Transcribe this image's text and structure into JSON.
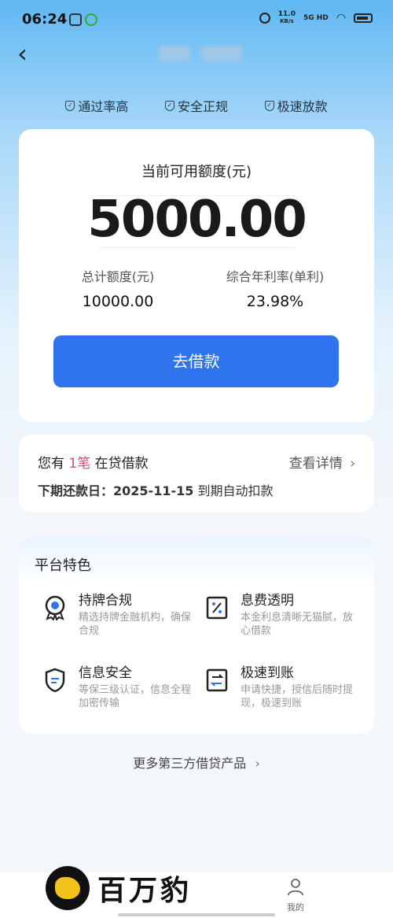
{
  "status_bar": {
    "time": "06:24",
    "net_speed_value": "11.0",
    "net_speed_unit": "KB/s",
    "network": "5G HD"
  },
  "badges": [
    "通过率高",
    "安全正规",
    "极速放款"
  ],
  "quota": {
    "label": "当前可用额度(元)",
    "amount": "5000.00",
    "total_label": "总计额度(元)",
    "total_value": "10000.00",
    "rate_label": "综合年利率(单利)",
    "rate_value": "23.98%",
    "button": "去借款"
  },
  "loan": {
    "prefix": "您有 ",
    "count": "1笔",
    "suffix": " 在贷借款",
    "more": "查看详情",
    "next_label": "下期还款日：",
    "next_date": "2025-11-15",
    "next_note": " 到期自动扣款"
  },
  "features": {
    "title": "平台特色",
    "items": [
      {
        "name": "持牌合规",
        "desc": "精选持牌金融机构，确保合规",
        "icon": "medal-icon"
      },
      {
        "name": "息费透明",
        "desc": "本金利息清晰无猫腻，放心借款",
        "icon": "percent-icon"
      },
      {
        "name": "信息安全",
        "desc": "等保三级认证，信息全程加密传输",
        "icon": "shield-icon"
      },
      {
        "name": "极速到账",
        "desc": "申请快捷，授信后随时提现，极速到账",
        "icon": "transfer-icon"
      }
    ]
  },
  "more_products": "更多第三方借贷产品",
  "bottom": {
    "logo_text": "百万豹",
    "tab_me": "我的"
  },
  "colors": {
    "primary_button": "#2f74ec",
    "highlight": "#d94a78"
  }
}
